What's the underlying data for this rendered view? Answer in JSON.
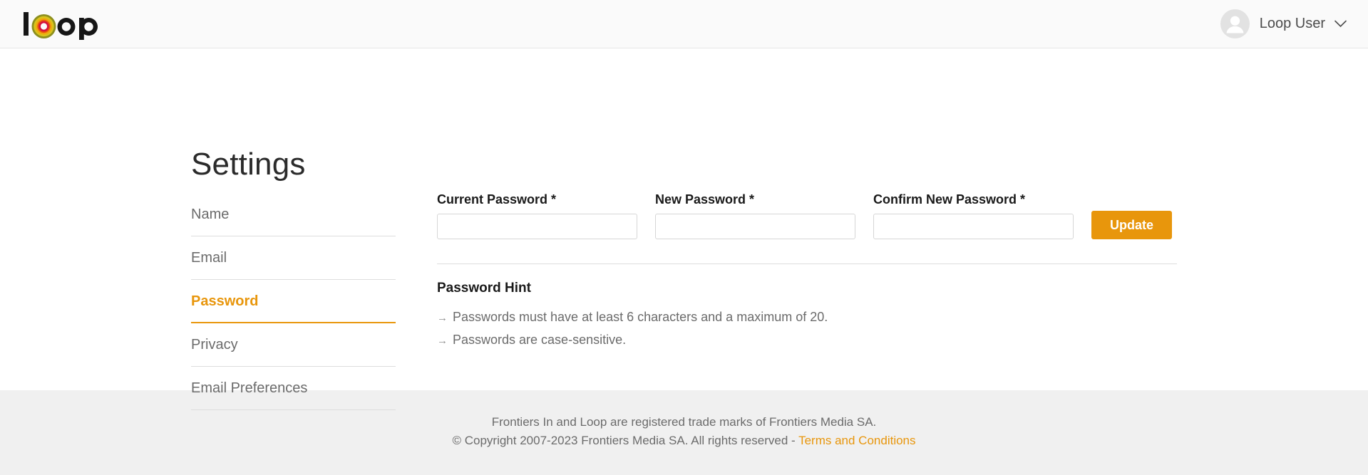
{
  "header": {
    "logo_alt": "Loop",
    "logo_text": "loop",
    "user": {
      "name": "Loop User",
      "avatar_icon": "user-avatar-icon",
      "chevron_icon": "chevron-down-icon"
    }
  },
  "page": {
    "title": "Settings"
  },
  "sidebar": {
    "items": [
      {
        "label": "Name",
        "active": false
      },
      {
        "label": "Email",
        "active": false
      },
      {
        "label": "Password",
        "active": true
      },
      {
        "label": "Privacy",
        "active": false
      },
      {
        "label": "Email Preferences",
        "active": false
      }
    ]
  },
  "form": {
    "fields": [
      {
        "label": "Current Password *",
        "value": "",
        "placeholder": ""
      },
      {
        "label": "New Password *",
        "value": "",
        "placeholder": ""
      },
      {
        "label": "Confirm New Password *",
        "value": "",
        "placeholder": ""
      }
    ],
    "submit_label": "Update"
  },
  "hint": {
    "title": "Password Hint",
    "bullet_glyph": "→",
    "items": [
      "Passwords must have at least 6 characters and a maximum of 20.",
      "Passwords are case-sensitive."
    ]
  },
  "footer": {
    "line1": "Frontiers In and Loop are registered trade marks of Frontiers Media SA.",
    "line2_prefix": "© Copyright 2007-2023 Frontiers Media SA. All rights reserved - ",
    "link_label": "Terms and Conditions"
  },
  "colors": {
    "accent_orange": "#e8960c",
    "header_bg": "#fafafa",
    "footer_bg": "#f0f0f0",
    "muted_text": "#6b6b6b"
  }
}
